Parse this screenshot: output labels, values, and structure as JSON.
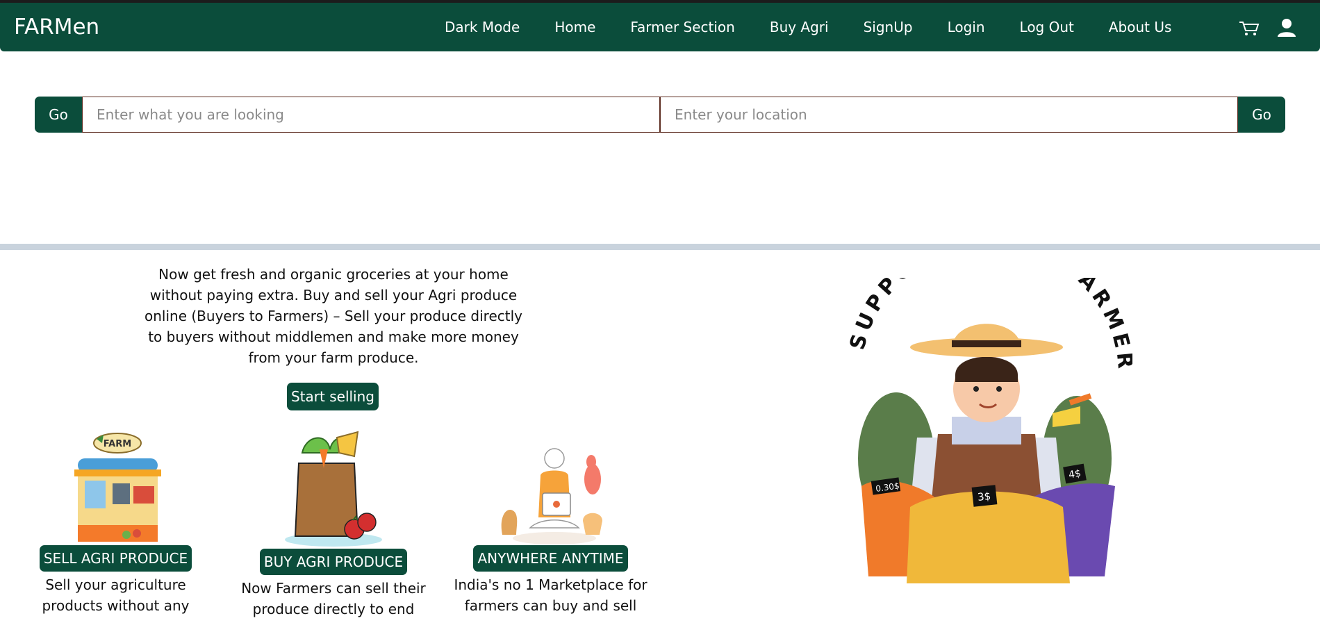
{
  "navbar": {
    "brand": "FARMen",
    "links": [
      "Dark Mode",
      "Home",
      "Farmer Section",
      "Buy Agri",
      "SignUp",
      "Login",
      "Log Out",
      "About Us"
    ],
    "icons": [
      "cart-icon",
      "user-icon"
    ]
  },
  "search": {
    "go_label_left": "Go",
    "go_label_right": "Go",
    "what_placeholder": "Enter what you are looking",
    "location_placeholder": "Enter your location"
  },
  "intro": {
    "text": "Now get fresh and organic groceries at your home without paying extra. Buy and sell your Agri produce online (Buyers to Farmers) – Sell your produce directly to buyers without middlemen and make more money from your farm produce.",
    "cta": "Start selling"
  },
  "features": [
    {
      "title": "SELL AGRI PRODUCE",
      "text": "Sell your agriculture products without any",
      "image": "farm-stall-illustration",
      "sign": "FARM"
    },
    {
      "title": "BUY AGRI PRODUCE",
      "text": "Now Farmers can sell their produce directly to end",
      "image": "grocery-bag-illustration"
    },
    {
      "title": "ANYWHERE ANYTIME",
      "text": "India's no 1 Marketplace for farmers can buy and sell",
      "image": "person-laptop-illustration"
    }
  ],
  "hero": {
    "image": "support-local-farmers-illustration",
    "text": "SUPPORT LOCAL FARMERS",
    "price_tags": [
      "0.30$",
      "3$",
      "4$"
    ]
  },
  "colors": {
    "primary": "#0b4d3b",
    "divider": "#c9d3dd"
  }
}
